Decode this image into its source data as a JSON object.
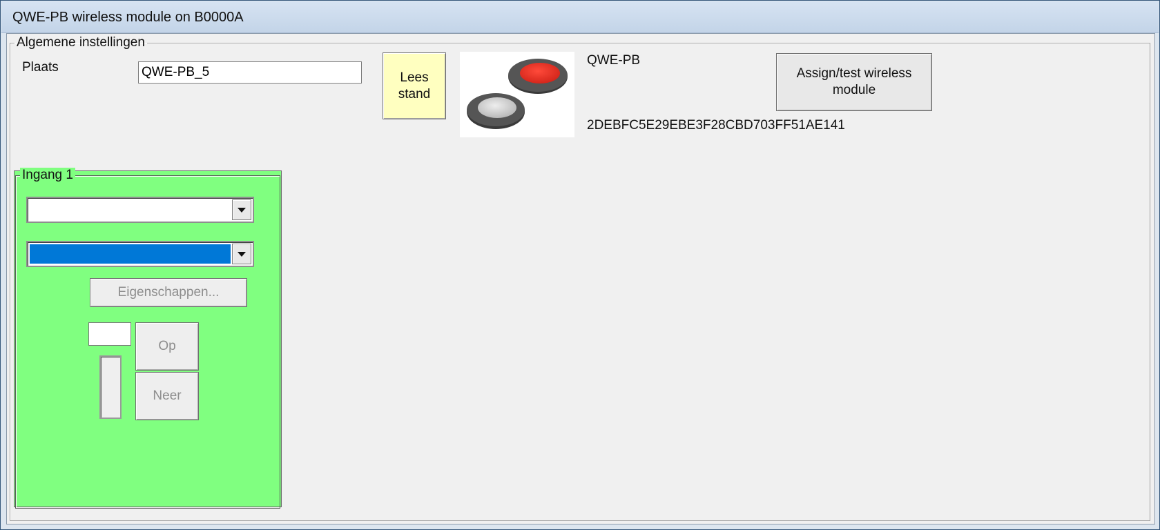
{
  "window": {
    "title": "QWE-PB wireless module on B0000A"
  },
  "general": {
    "legend": "Algemene instellingen",
    "plaats_label": "Plaats",
    "plaats_value": "QWE-PB_5",
    "read_button": "Lees stand",
    "device_type": "QWE-PB",
    "device_id": "2DEBFC5E29EBE3F28CBD703FF51AE141",
    "assign_button": "Assign/test wireless module"
  },
  "input1": {
    "legend": "Ingang 1",
    "combo1_value": "",
    "combo2_value": "",
    "properties_button": "Eigenschappen...",
    "value_field": "",
    "up_button": "Op",
    "down_button": "Neer"
  },
  "colors": {
    "input_panel_bg": "#80ff80",
    "read_button_bg": "#ffffc0",
    "selection_bg": "#0078d7",
    "button_top_red": "#e53025"
  },
  "icons": {
    "device_image": "wireless-pushbutton-image"
  }
}
